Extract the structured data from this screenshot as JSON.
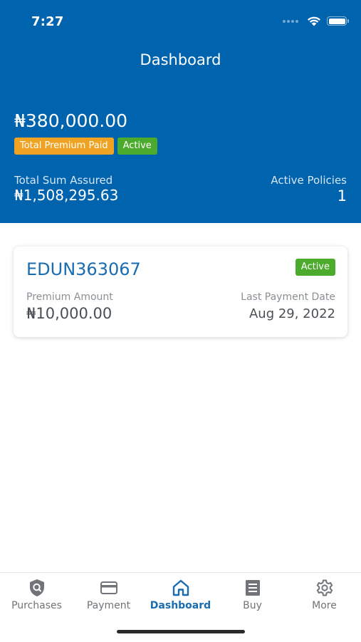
{
  "status_bar": {
    "time": "7:27"
  },
  "header": {
    "title": "Dashboard",
    "total_premium_value": "₦380,000.00",
    "total_premium_badge": "Total Premium Paid",
    "status_badge": "Active",
    "sum_assured_label": "Total Sum Assured",
    "sum_assured_value": "₦1,508,295.63",
    "active_policies_label": "Active Policies",
    "active_policies_value": "1"
  },
  "policy_card": {
    "policy_number": "EDUN363067",
    "status": "Active",
    "premium_label": "Premium Amount",
    "premium_value": "₦10,000.00",
    "last_payment_label": "Last Payment Date",
    "last_payment_value": "Aug 29, 2022"
  },
  "tabs": [
    {
      "label": "Purchases",
      "icon": "shield-icon",
      "active": false
    },
    {
      "label": "Payment",
      "icon": "credit-card-icon",
      "active": false
    },
    {
      "label": "Dashboard",
      "icon": "home-icon",
      "active": true
    },
    {
      "label": "Buy",
      "icon": "document-icon",
      "active": false
    },
    {
      "label": "More",
      "icon": "gear-icon",
      "active": false
    }
  ],
  "colors": {
    "brand_blue": "#0063ae",
    "accent_blue": "#1a6cb0",
    "badge_orange": "#f0a323",
    "badge_green": "#4caa2c"
  }
}
